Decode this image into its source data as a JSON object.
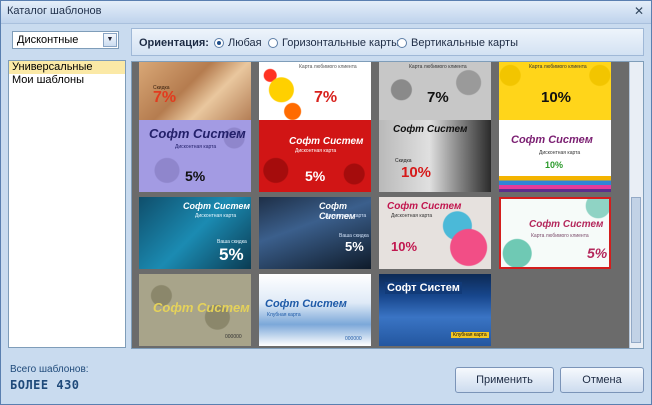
{
  "window": {
    "title": "Каталог шаблонов",
    "close_glyph": "✕"
  },
  "category": {
    "selected": "Дисконтные"
  },
  "list": {
    "items": [
      "Универсальные",
      "Мои шаблоны"
    ]
  },
  "orientation": {
    "label": "Ориентация:",
    "options": [
      "Любая",
      "Горизонтальные карты",
      "Вертикальные карты"
    ],
    "selected": "Любая"
  },
  "cards": [
    {
      "pct": "7%",
      "sub": "Скидка",
      "tiny": "Карта любимого клиента"
    },
    {
      "pct": "7%",
      "tiny": "Карта любимого клиента"
    },
    {
      "pct": "7%",
      "tiny": "Карта любимого клиента"
    },
    {
      "pct": "10%",
      "tiny": "Карта любимого клиента"
    },
    {
      "title": "Софт Систем",
      "sub": "Дисконтная карта",
      "pct": "5%"
    },
    {
      "title": "Софт Систем",
      "sub": "Дисконтная карта",
      "pct": "5%"
    },
    {
      "title": "Софт Систем",
      "sub": "Скидка",
      "pct": "10%"
    },
    {
      "title": "Софт Систем",
      "sub": "Дисконтная карта",
      "pct": "10%"
    },
    {
      "title": "Софт Систем",
      "sub": "Дисконтная карта",
      "pct": "5%",
      "sub2": "Ваша скидка"
    },
    {
      "title": "Софт Систем",
      "sub": "Дисконтная карта",
      "pct": "5%",
      "sub2": "Ваша скидка"
    },
    {
      "title": "Софт Систем",
      "sub": "Дисконтная карта",
      "pct": "10%"
    },
    {
      "title": "Софт Систем",
      "sub": "Карта любимого клиента",
      "pct": "5%"
    },
    {
      "title": "Софт Систем",
      "sub": "",
      "num": "000000"
    },
    {
      "title": "Софт Систем",
      "sub": "Клубная карта",
      "num": "000000"
    },
    {
      "title": "Софт Систем",
      "sub": "Клубная карта"
    }
  ],
  "footer": {
    "total_label": "Всего шаблонов:",
    "total_value": "БОЛЕЕ 430",
    "apply_label": "Применить",
    "cancel_label": "Отмена"
  },
  "colors": {
    "selection_outline": "#d41d1d",
    "accent": "#1f4a7a"
  },
  "icons": {
    "dropdown": "chevron-down-icon",
    "close": "close-icon"
  }
}
